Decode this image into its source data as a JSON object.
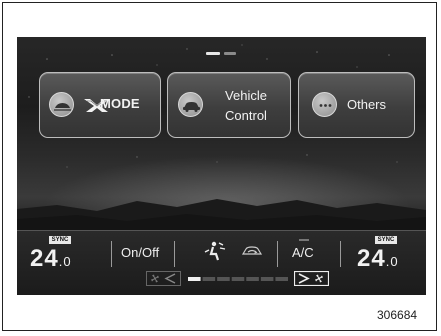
{
  "pager": {
    "pages": 2,
    "active": 1
  },
  "tiles": [
    {
      "id": "xmode",
      "label": "MODE",
      "icon": "x-mode-icon"
    },
    {
      "id": "vehicle",
      "label_line1": "Vehicle",
      "label_line2": "Control",
      "icon": "vehicle-icon"
    },
    {
      "id": "others",
      "label": "Others",
      "icon": "more-icon"
    }
  ],
  "climate": {
    "left": {
      "sync_badge": "SYNC",
      "temp_main": "24",
      "temp_decimal": ".0"
    },
    "right": {
      "sync_badge": "SYNC",
      "temp_main": "24",
      "temp_decimal": ".0"
    },
    "onoff_label": "On/Off",
    "ac_label": "A/C",
    "fan_level_fraction": 0.1
  },
  "figure_number": "306684",
  "colors": {
    "screen_bg": "#111111",
    "tile_border": "#bdbdbd",
    "text": "#f2f2f2"
  }
}
